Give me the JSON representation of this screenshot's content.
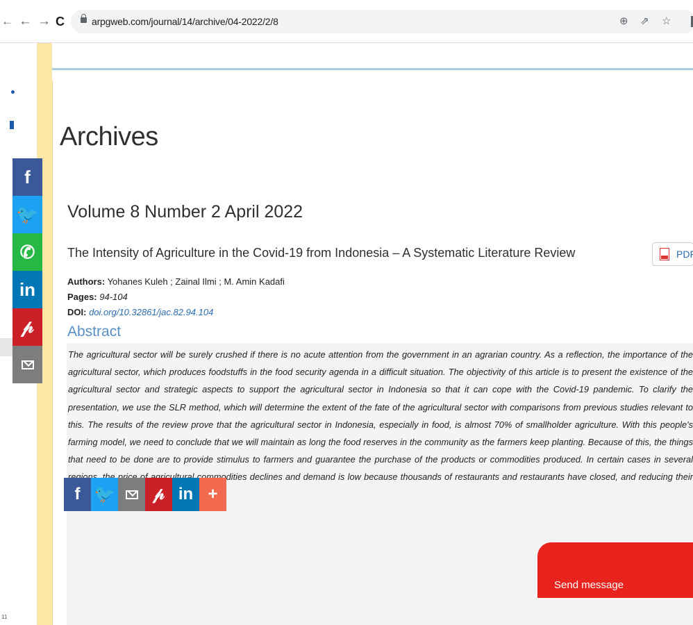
{
  "browser": {
    "url": "arpgweb.com/journal/14/archive/04-2022/2/8",
    "back_glyph": "←",
    "forward_glyph": "→",
    "reload_glyph": "C",
    "outer_back_glyph": "←"
  },
  "page": {
    "heading": "Archives",
    "volume": "Volume 8 Number 2 April 2022",
    "article": {
      "title": "The Intensity of Agriculture in the Covid-19 from Indonesia – A Systematic Literature Review",
      "pdf_label": "PDF",
      "authors_label": "Authors:",
      "authors": "Yohanes Kuleh ; Zainal Ilmi ; M. Amin Kadafi",
      "pages_label": "Pages:",
      "pages": "94-104",
      "doi_label": "DOI:",
      "doi": "doi.org/10.32861/jac.82.94.104",
      "abstract_heading": "Abstract",
      "abstract": "The agricultural sector will be surely crushed if there is no acute attention from the government in an agrarian country. As a reflection, the importance of the agricultural sector, which produces foodstuffs in the food security agenda in a difficult situation. The objectivity of this article is to present the existence of the agricultural sector and strategic aspects to support the agricultural sector in Indonesia so that it can cope with the Covid-19 pandemic. To clarify the presentation, we use the SLR method, which will determine the extent of the fate of the agricultural sector with comparisons from previous studies relevant to this. The results of the review prove that the agricultural sector in Indonesia, especially in food, is almost 70% of smallholder agriculture. With this people's farming model, we need to conclude that we will maintain as long the food reserves in the community as the farmers keep planting. Because of this, the things that need to be done are to provide stimulus to farmers and guarantee the purchase of the products or commodities produced. In certain cases in several regions, the price of agricultural commodities declines and demand is low because thousands of restaurants and restaurants have closed, and reducing their sales capacity."
    },
    "gutter_number": "11"
  },
  "share_side": [
    {
      "name": "facebook",
      "glyph": "f",
      "color": "#3b5998"
    },
    {
      "name": "twitter",
      "glyph": "🐦",
      "color": "#1da1f2"
    },
    {
      "name": "whatsapp",
      "glyph": "✆",
      "color": "#25b844"
    },
    {
      "name": "linkedin",
      "glyph": "in",
      "color": "#0077b5"
    },
    {
      "name": "pinterest",
      "glyph": "𝓅",
      "color": "#cb2027"
    },
    {
      "name": "email",
      "glyph": "",
      "color": "#7d7d7d"
    }
  ],
  "share_bottom": [
    {
      "name": "facebook",
      "glyph": "f",
      "color": "#3b5998"
    },
    {
      "name": "twitter",
      "glyph": "🐦",
      "color": "#1da1f2"
    },
    {
      "name": "email",
      "glyph": "",
      "color": "#7d7d7d"
    },
    {
      "name": "pinterest",
      "glyph": "𝓅",
      "color": "#cb2027"
    },
    {
      "name": "linkedin",
      "glyph": "in",
      "color": "#0077b5"
    },
    {
      "name": "more",
      "glyph": "+",
      "color": "#f26a4f"
    }
  ],
  "chat": {
    "label": "Send message",
    "color": "#e8221c"
  }
}
